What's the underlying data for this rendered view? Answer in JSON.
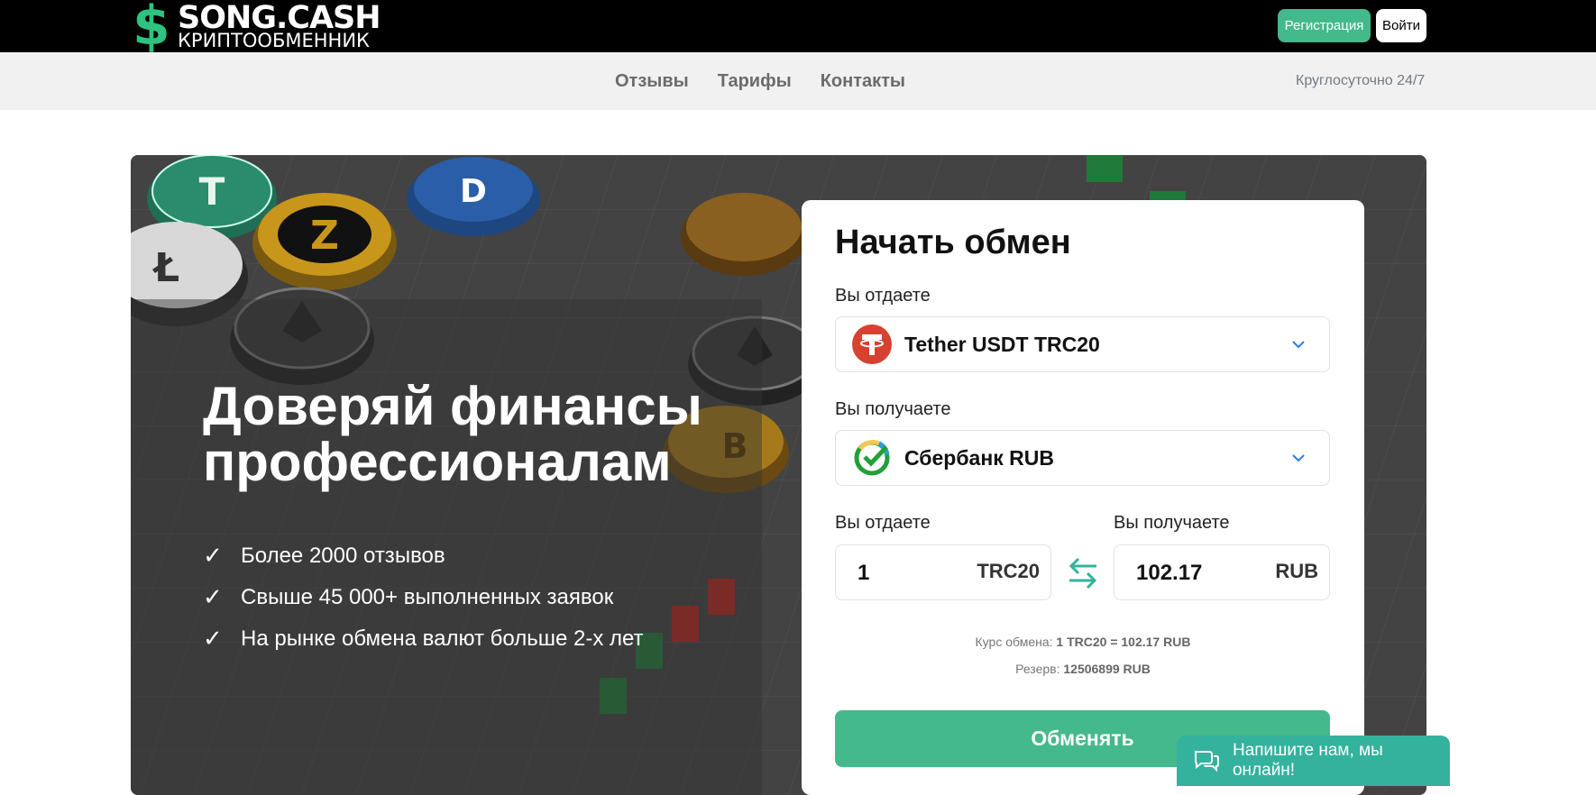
{
  "header": {
    "logo_symbol": "$",
    "logo_name": "SONG.CASH",
    "logo_subtitle": "КРИПТООБМЕННИК",
    "register_label": "Регистрация",
    "login_label": "Войти"
  },
  "nav": {
    "links": [
      "Отзывы",
      "Тарифы",
      "Контакты"
    ],
    "hours": "Круглосуточно 24/7"
  },
  "hero": {
    "title": "Доверяй финансы профессионалам",
    "features": [
      "Более 2000 отзывов",
      "Свыше 45 000+ выполненных заявок",
      "На рынке обмена валют больше 2-х лет"
    ]
  },
  "exchange": {
    "title": "Начать обмен",
    "give_label": "Вы отдаете",
    "give_currency": "Tether USDT TRC20",
    "get_label": "Вы получаете",
    "get_currency": "Сбербанк RUB",
    "amount_give_label": "Вы отдаете",
    "amount_get_label": "Вы получаете",
    "amount_give": "1",
    "amount_give_currency": "TRC20",
    "amount_get": "102.17",
    "amount_get_currency": "RUB",
    "rate_label": "Курс обмена:",
    "rate_value": "1 TRC20 = 102.17 RUB",
    "reserve_label": "Резерв:",
    "reserve_value": "12506899 RUB",
    "submit_label": "Обменять"
  },
  "chat": {
    "text": "Напишите нам, мы онлайн!"
  },
  "colors": {
    "accent": "#44b98c",
    "chat": "#34b29e",
    "tether": "#d7412f",
    "sber": "#21a038"
  }
}
